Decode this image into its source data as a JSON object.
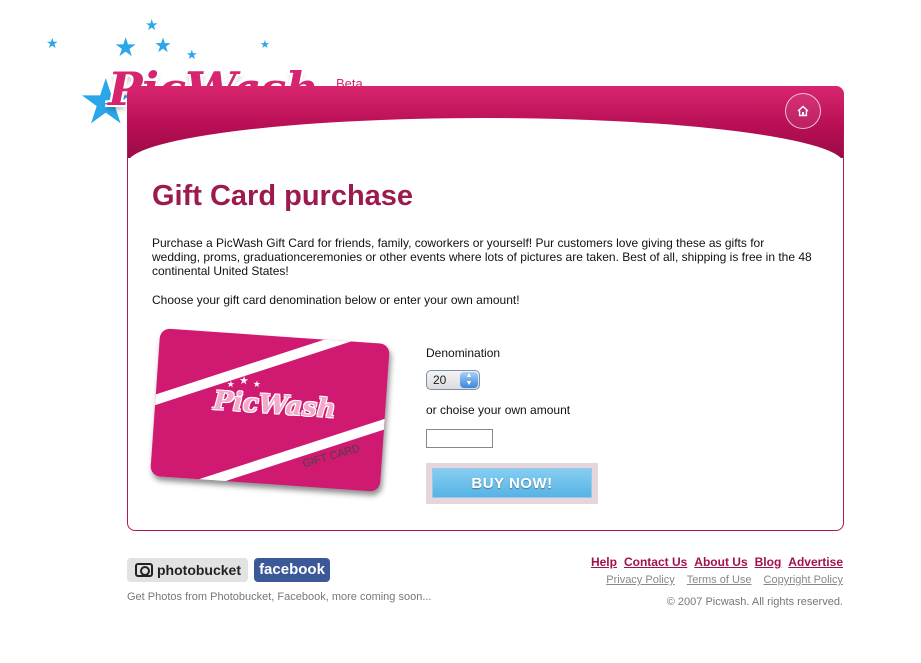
{
  "brand": {
    "logo_text": "PicWash",
    "beta_label": "Beta",
    "colors": {
      "primary": "#c3165e",
      "title": "#9c1a4f",
      "accent_blue": "#2aa7e8"
    }
  },
  "header": {
    "home_icon": "home-icon"
  },
  "main": {
    "title": "Gift Card purchase",
    "intro": "Purchase a PicWash Gift Card for friends, family, coworkers or yourself! Pur customers love giving these as gifts for wedding, proms, graduationceremonies or other events where lots of pictures are taken. Best of all, shipping is free in the 48 continental United States!",
    "instruction": "Choose your gift card denomination below or enter your own amount!",
    "card": {
      "logo": "PicWash",
      "label": "GIFT CARD"
    }
  },
  "form": {
    "denomination_label": "Denomination",
    "denomination_value": "20",
    "custom_amount_label": "or choise your own amount",
    "custom_amount_value": "",
    "buy_label": "BUY NOW!"
  },
  "footer": {
    "photobucket_label": "photobucket",
    "facebook_label": "facebook",
    "note": "Get Photos from Photobucket, Facebook, more coming soon...",
    "links": [
      "Help",
      "Contact Us",
      "About Us",
      "Blog",
      "Advertise"
    ],
    "legal": [
      "Privacy Policy",
      "Terms of Use",
      "Copyright Policy"
    ],
    "copyright": "© 2007 Picwash. All rights reserved."
  }
}
